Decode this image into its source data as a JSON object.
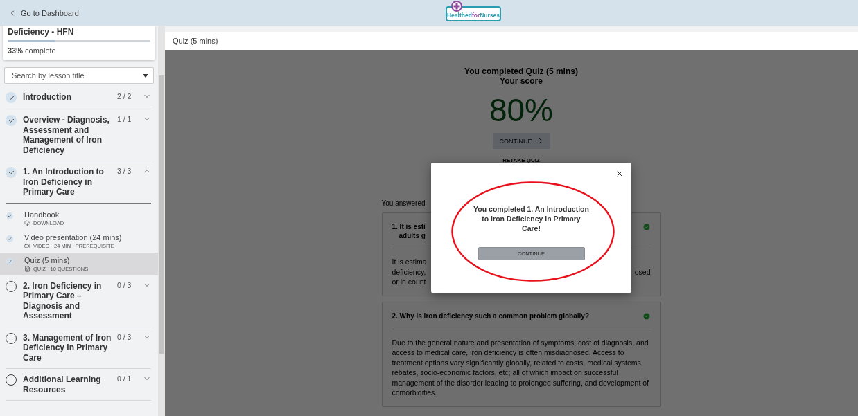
{
  "topbar": {
    "back_link": "Go to Dashboard",
    "logo": [
      {
        "text": "Healthed",
        "color": "#2a9db0"
      },
      {
        "text": "for",
        "color": "#8e4a9e"
      },
      {
        "text": "Nurses",
        "color": "#2a9db0"
      }
    ]
  },
  "course": {
    "title": "Deficiency - HFN",
    "progress": {
      "level": 0.33,
      "percent": "33%",
      "label": "complete"
    }
  },
  "search": {
    "placeholder": "Search by lesson title"
  },
  "sections": [
    {
      "title": "Introduction",
      "count": "2 / 2",
      "completed": true,
      "expanded": false
    },
    {
      "title": "Overview - Diagnosis, Assessment and Management of Iron Deficiency",
      "count": "1 / 1",
      "completed": true,
      "expanded": false
    },
    {
      "title": "1. An Introduction to Iron Deficiency in Primary Care",
      "count": "3 / 3",
      "completed": true,
      "expanded": true,
      "lessons": [
        {
          "title": "Handbook",
          "kind": "download",
          "meta": "DOWNLOAD",
          "completed": true,
          "selected": false
        },
        {
          "title": "Video presentation (24 mins)",
          "kind": "video",
          "meta": "VIDEO · 24 MIN · PREREQUISITE",
          "completed": true,
          "selected": false
        },
        {
          "title": "Quiz (5 mins)",
          "kind": "quiz",
          "meta": "QUIZ · 10 QUESTIONS",
          "completed": true,
          "selected": true
        }
      ]
    },
    {
      "title": "2. Iron Deficiency in Primary Care – Diagnosis and Assessment",
      "count": "0 / 3",
      "completed": false,
      "expanded": false
    },
    {
      "title": "3. Management of Iron Deficiency in Primary Care",
      "count": "0 / 3",
      "completed": false,
      "expanded": false
    },
    {
      "title": "Additional Learning Resources",
      "count": "0 / 1",
      "completed": false,
      "expanded": false
    }
  ],
  "content": {
    "header": "Quiz (5 mins)",
    "result": {
      "heading": "You completed Quiz (5 mins)",
      "subheading": "Your score",
      "score": "80%",
      "continue": "CONTINUE",
      "retake": "RETAKE QUIZ"
    },
    "answered": "You answered",
    "questions": [
      {
        "title_lines": [
          "1. It is esti",
          "adults g"
        ],
        "correct": true,
        "body_lines": [
          {
            "left": "It is estima"
          },
          {
            "left": "deficiency,",
            "right": "osed"
          },
          {
            "left": "or in count"
          }
        ]
      },
      {
        "title_lines": [
          "2. Why is iron deficiency such a common problem globally?"
        ],
        "correct": true,
        "body_lines": [
          {
            "left": "Due to the general nature and presentation of symptoms, cost of diagnosis, and access to medical care, iron deficiency is often misdiagnosed. Access to treatment options vary significantly globally, related to costs, medical systems, rebates, socio-economic factors, etc; all of which impact on successful management of the disorder leading to prolonged suffering, and development of comorbidities."
          }
        ]
      }
    ]
  },
  "modal": {
    "message": "You completed 1. An Introduction to Iron Deficiency in Primary Care!",
    "button": "CONTINUE"
  }
}
